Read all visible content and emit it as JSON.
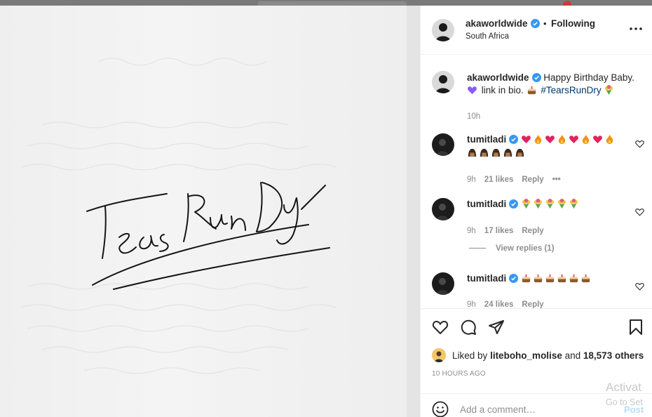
{
  "post": {
    "author": "akaworldwide",
    "location": "South Africa",
    "follow_dot": "•",
    "follow_status": "Following",
    "caption": {
      "line1": "Happy Birthday Baby.",
      "line2_a": "link in bio.",
      "hashtag": "#TearsRunDry",
      "time": "10h"
    }
  },
  "comments": [
    {
      "user": "tumitladi",
      "time": "9h",
      "likes": "21 likes",
      "reply": "Reply",
      "more": "•••"
    },
    {
      "user": "tumitladi",
      "time": "9h",
      "likes": "17 likes",
      "reply": "Reply"
    },
    {
      "user": "tumitladi",
      "time": "9h",
      "likes": "24 likes",
      "reply": "Reply"
    }
  ],
  "view_replies": "View replies (1)",
  "likes": {
    "prefix": "Liked by",
    "user": "liteboho_molise",
    "middle": "and",
    "others": "18,573 others"
  },
  "posted_ago": "10 HOURS AGO",
  "add_comment": {
    "placeholder": "Add a comment…",
    "post": "Post"
  },
  "watermark": {
    "line1": "Activat",
    "line2": "Go to Set"
  },
  "colors": {
    "verified": "#3897f0",
    "link": "#00376b",
    "muted": "#8e8e8e",
    "post_disabled": "#b2dffc"
  },
  "icons": [
    "heart-icon",
    "comment-icon",
    "share-icon",
    "bookmark-icon",
    "emoji-icon",
    "more-icon",
    "verified-badge-icon"
  ]
}
